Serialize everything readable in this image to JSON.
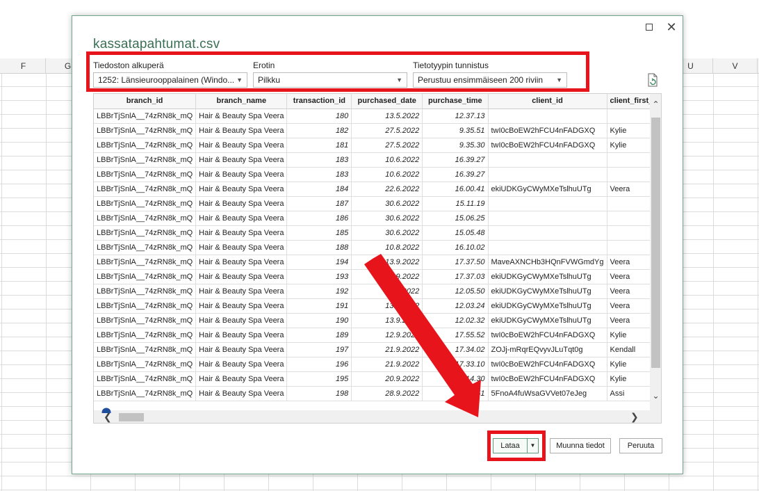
{
  "sheet": {
    "columns_left": [
      "F",
      "G"
    ],
    "columns_right": [
      "U",
      "V"
    ]
  },
  "dialog": {
    "title": "kassatapahtumat.csv",
    "options": {
      "file_origin": {
        "label": "Tiedoston alkuperä",
        "value": "1252: Länsieurooppalainen (Windo..."
      },
      "delimiter": {
        "label": "Erotin",
        "value": "Pilkku"
      },
      "type_detection": {
        "label": "Tietotyypin tunnistus",
        "value": "Perustuu ensimmäiseen 200 riviin"
      }
    },
    "table": {
      "headers": [
        "branch_id",
        "branch_name",
        "transaction_id",
        "purchased_date",
        "purchase_time",
        "client_id",
        "client_first_n"
      ],
      "rows": [
        [
          "LBBrTjSnlA__74zRN8k_mQ",
          "Hair & Beauty Spa Veera",
          "180",
          "13.5.2022",
          "12.37.13",
          "",
          ""
        ],
        [
          "LBBrTjSnlA__74zRN8k_mQ",
          "Hair & Beauty Spa Veera",
          "182",
          "27.5.2022",
          "9.35.51",
          "twI0cBoEW2hFCU4nFADGXQ",
          "Kylie"
        ],
        [
          "LBBrTjSnlA__74zRN8k_mQ",
          "Hair & Beauty Spa Veera",
          "181",
          "27.5.2022",
          "9.35.30",
          "twI0cBoEW2hFCU4nFADGXQ",
          "Kylie"
        ],
        [
          "LBBrTjSnlA__74zRN8k_mQ",
          "Hair & Beauty Spa Veera",
          "183",
          "10.6.2022",
          "16.39.27",
          "",
          ""
        ],
        [
          "LBBrTjSnlA__74zRN8k_mQ",
          "Hair & Beauty Spa Veera",
          "183",
          "10.6.2022",
          "16.39.27",
          "",
          ""
        ],
        [
          "LBBrTjSnlA__74zRN8k_mQ",
          "Hair & Beauty Spa Veera",
          "184",
          "22.6.2022",
          "16.00.41",
          "ekiUDKGyCWyMXeTslhuUTg",
          "Veera"
        ],
        [
          "LBBrTjSnlA__74zRN8k_mQ",
          "Hair & Beauty Spa Veera",
          "187",
          "30.6.2022",
          "15.11.19",
          "",
          ""
        ],
        [
          "LBBrTjSnlA__74zRN8k_mQ",
          "Hair & Beauty Spa Veera",
          "186",
          "30.6.2022",
          "15.06.25",
          "",
          ""
        ],
        [
          "LBBrTjSnlA__74zRN8k_mQ",
          "Hair & Beauty Spa Veera",
          "185",
          "30.6.2022",
          "15.05.48",
          "",
          ""
        ],
        [
          "LBBrTjSnlA__74zRN8k_mQ",
          "Hair & Beauty Spa Veera",
          "188",
          "10.8.2022",
          "16.10.02",
          "",
          ""
        ],
        [
          "LBBrTjSnlA__74zRN8k_mQ",
          "Hair & Beauty Spa Veera",
          "194",
          "13.9.2022",
          "17.37.50",
          "MaveAXNCHb3HQnFVWGmdYg",
          "Veera"
        ],
        [
          "LBBrTjSnlA__74zRN8k_mQ",
          "Hair & Beauty Spa Veera",
          "193",
          "13.9.2022",
          "17.37.03",
          "ekiUDKGyCWyMXeTslhuUTg",
          "Veera"
        ],
        [
          "LBBrTjSnlA__74zRN8k_mQ",
          "Hair & Beauty Spa Veera",
          "192",
          "13.9.2022",
          "12.05.50",
          "ekiUDKGyCWyMXeTslhuUTg",
          "Veera"
        ],
        [
          "LBBrTjSnlA__74zRN8k_mQ",
          "Hair & Beauty Spa Veera",
          "191",
          "13.9.2022",
          "12.03.24",
          "ekiUDKGyCWyMXeTslhuUTg",
          "Veera"
        ],
        [
          "LBBrTjSnlA__74zRN8k_mQ",
          "Hair & Beauty Spa Veera",
          "190",
          "13.9.2022",
          "12.02.32",
          "ekiUDKGyCWyMXeTslhuUTg",
          "Veera"
        ],
        [
          "LBBrTjSnlA__74zRN8k_mQ",
          "Hair & Beauty Spa Veera",
          "189",
          "12.9.2022",
          "17.55.52",
          "twI0cBoEW2hFCU4nFADGXQ",
          "Kylie"
        ],
        [
          "LBBrTjSnlA__74zRN8k_mQ",
          "Hair & Beauty Spa Veera",
          "197",
          "21.9.2022",
          "17.34.02",
          "ZOJj-mRqrEQvyvJLuTqt0g",
          "Kendall"
        ],
        [
          "LBBrTjSnlA__74zRN8k_mQ",
          "Hair & Beauty Spa Veera",
          "196",
          "21.9.2022",
          "17.33.10",
          "twI0cBoEW2hFCU4nFADGXQ",
          "Kylie"
        ],
        [
          "LBBrTjSnlA__74zRN8k_mQ",
          "Hair & Beauty Spa Veera",
          "195",
          "20.9.2022",
          "14.14.30",
          "twI0cBoEW2hFCU4nFADGXQ",
          "Kylie"
        ],
        [
          "LBBrTjSnlA__74zRN8k_mQ",
          "Hair & Beauty Spa Veera",
          "198",
          "28.9.2022",
          "16.53.51",
          "5FnoA4fuWsaGVVet07eJeg",
          "Assi"
        ]
      ]
    },
    "buttons": {
      "load": "Lataa",
      "transform": "Muunna tiedot",
      "cancel": "Peruuta"
    },
    "icons": {
      "maximize": "maximize-icon",
      "close": "close-icon",
      "refresh": "refresh-icon",
      "dropdown": "chevron-down-icon",
      "help": "help-icon"
    },
    "colors": {
      "highlight": "#e8141c",
      "title": "#3a6f55",
      "arrow": "#e8141c"
    }
  }
}
